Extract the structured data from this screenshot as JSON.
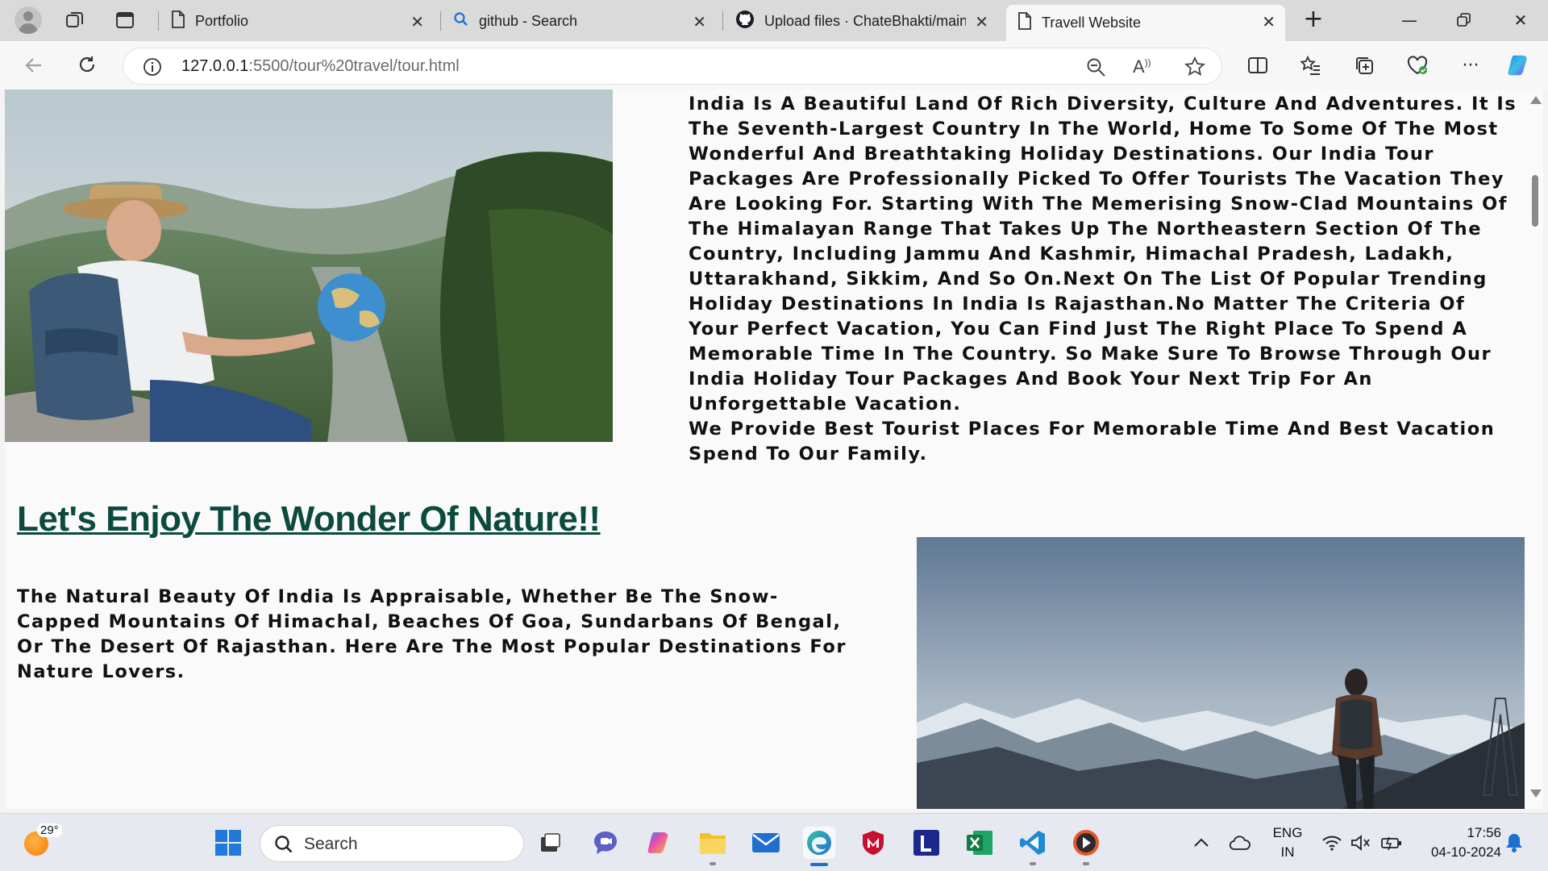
{
  "browser": {
    "tabs": [
      {
        "title": "Portfolio",
        "icon": "page-icon"
      },
      {
        "title": "github - Search",
        "icon": "search-icon"
      },
      {
        "title": "Upload files · ChateBhakti/mainf",
        "icon": "github-icon"
      },
      {
        "title": "Travell Website",
        "icon": "page-icon"
      }
    ],
    "url_host": "127.0.0.1",
    "url_rest": ":5500/tour%20travel/tour.html"
  },
  "page": {
    "intro_paragraph_1": "India Is A Beautiful Land Of Rich Diversity, Culture And Adventures. It Is The Seventh-Largest Country In The World, Home To Some Of The Most Wonderful And Breathtaking Holiday Destinations. Our India Tour Packages Are Professionally Picked To Offer Tourists The Vacation They Are Looking For. Starting With The Memerising Snow-Clad Mountains Of The Himalayan Range That Takes Up The Northeastern Section Of The Country, Including Jammu And Kashmir, Himachal Pradesh, Ladakh, Uttarakhand, Sikkim, And So On.Next On The List Of Popular Trending Holiday Destinations In India Is Rajasthan.No Matter The Criteria Of Your Perfect Vacation, You Can Find Just The Right Place To Spend A Memorable Time In The Country. So Make Sure To Browse Through Our India Holiday Tour Packages And Book Your Next Trip For An Unforgettable Vacation.",
    "intro_paragraph_2": "We Provide Best Tourist Places For Memorable Time And Best Vacation Spend To Our Family.",
    "nature_heading": "Let's Enjoy The Wonder Of Nature!!",
    "nature_paragraph": "The Natural Beauty Of India Is Appraisable, Whether Be The Snow-Capped Mountains Of Himachal, Beaches Of Goa, Sundarbans Of Bengal, Or The Desert Of Rajasthan. Here Are The Most Popular Destinations For Nature Lovers.",
    "heading_color": "#0c4a3e"
  },
  "taskbar": {
    "weather_temp": "29°",
    "search_label": "Search",
    "language_1": "ENG",
    "language_2": "IN",
    "time": "17:56",
    "date": "04-10-2024",
    "accent": "#1f6fd1"
  }
}
